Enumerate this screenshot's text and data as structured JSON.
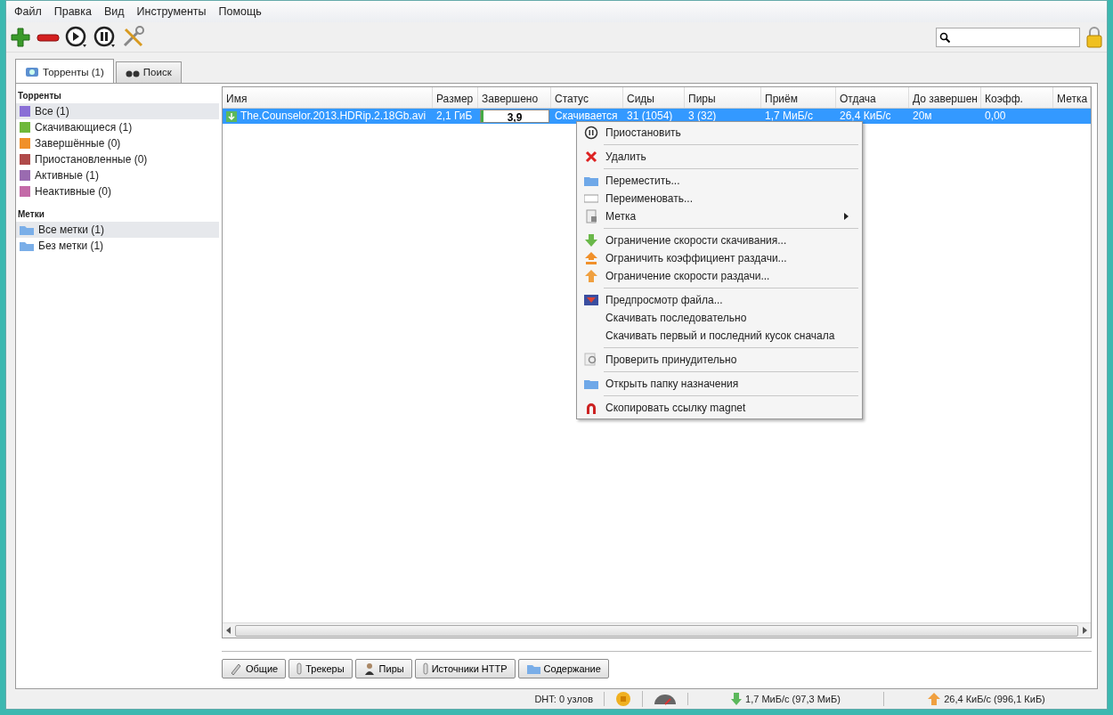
{
  "menu_bar": [
    "Файл",
    "Правка",
    "Вид",
    "Инструменты",
    "Помощь"
  ],
  "lock": {
    "locked": true
  },
  "tabs": [
    {
      "label": "Торренты (1)",
      "selected": true
    },
    {
      "label": "Поиск",
      "selected": false
    }
  ],
  "sidebar": {
    "sections": [
      {
        "title": "Торренты",
        "items": [
          {
            "label": "Все (1)",
            "selected": true,
            "color": "#8a6fd6"
          },
          {
            "label": "Скачивающиеся (1)",
            "selected": false,
            "color": "#6fb83a"
          },
          {
            "label": "Завершённые (0)",
            "selected": false,
            "color": "#f0902a"
          },
          {
            "label": "Приостановленные (0)",
            "selected": false,
            "color": "#b04a4a"
          },
          {
            "label": "Активные (1)",
            "selected": false,
            "color": "#9a6bb0"
          },
          {
            "label": "Неактивные (0)",
            "selected": false,
            "color": "#c46aa8"
          }
        ]
      },
      {
        "title": "Метки",
        "items": [
          {
            "label": "Все метки (1)",
            "selected": true,
            "color": "#7aaee8"
          },
          {
            "label": "Без метки (1)",
            "selected": false,
            "color": "#7aaee8"
          }
        ]
      }
    ]
  },
  "table": {
    "columns": [
      "Имя",
      "Размер",
      "Завершено",
      "Статус",
      "Сиды",
      "Пиры",
      "Приём",
      "Отдача",
      "До завершен",
      "Коэфф.",
      "Метка"
    ],
    "rows": [
      {
        "selected": true,
        "name": "The.Counselor.2013.HDRip.2.18Gb.avi",
        "size": "2,1 ГиБ",
        "progress": "3,9",
        "level": 0.039,
        "status": "Скачивается",
        "seeds": "31 (1054)",
        "peers": "3 (32)",
        "down": "1,7 МиБ/с",
        "up": "26,4 КиБ/с",
        "eta": "20м",
        "ratio": "0,00"
      }
    ]
  },
  "context_menu": {
    "groups": [
      [
        "Приостановить"
      ],
      [
        "Удалить"
      ],
      [
        "Переместить...",
        "Переименовать...",
        "Метка"
      ],
      [
        "Ограничение скорости скачивания...",
        "Ограничить коэффициент раздачи...",
        "Ограничение скорости раздачи..."
      ],
      [
        "Предпросмотр файла...",
        "Скачивать последовательно",
        "Скачивать первый и последний кусок сначала"
      ],
      [
        "Проверить принудительно"
      ],
      [
        "Открыть папку назначения"
      ],
      [
        "Скопировать ссылку magnet"
      ]
    ]
  },
  "detail_tabs": [
    "Общие",
    "Трекеры",
    "Пиры",
    "Источники HTTP",
    "Содержание"
  ],
  "status_bar": {
    "dht": "DHT: 0 узлов",
    "download": "1,7 МиБ/с (97,3 МиБ)",
    "upload": "26,4 КиБ/с (996,1 КиБ)"
  }
}
